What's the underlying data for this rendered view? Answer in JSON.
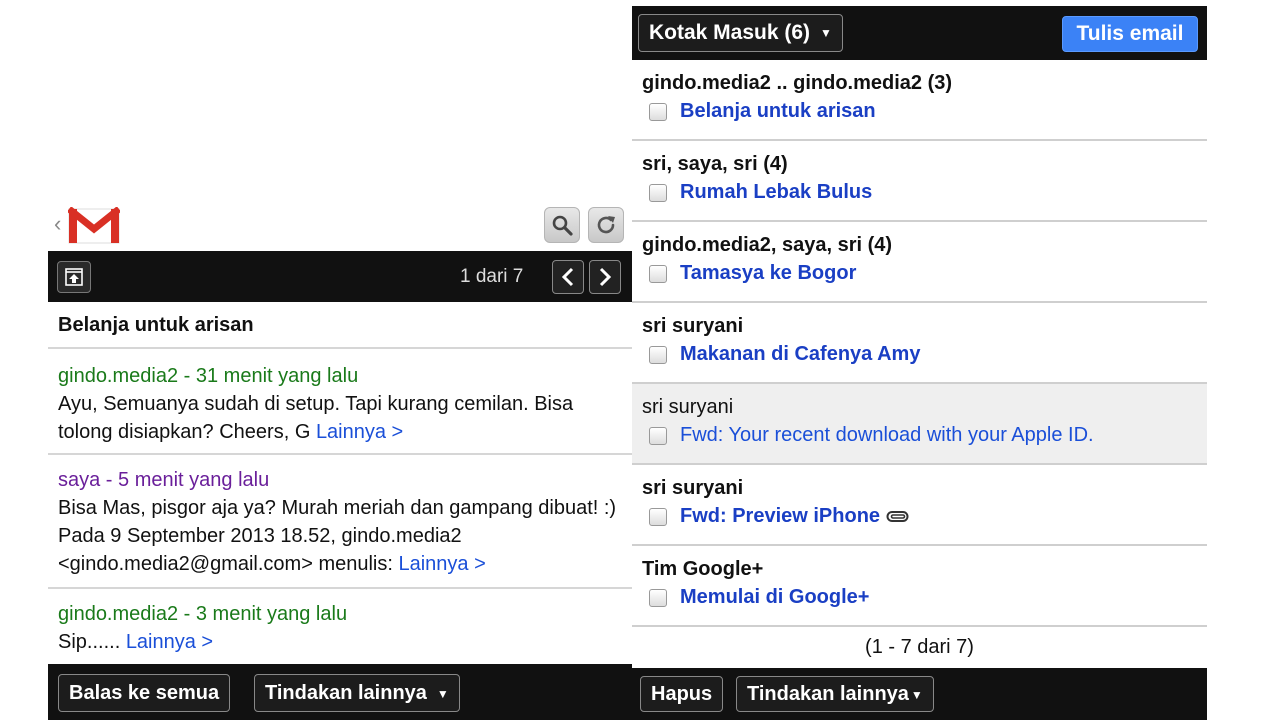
{
  "left": {
    "header": {
      "icons": [
        "back-chevron-icon",
        "gmail-logo",
        "search-icon",
        "refresh-icon"
      ]
    },
    "toolbar": {
      "pager_text": "1 dari 7"
    },
    "thread_subject": "Belanja untuk arisan",
    "messages": [
      {
        "head": "gindo.media2 - 31 menit yang lalu",
        "color": "#1a7a1a",
        "body": "Ayu, Semuanya sudah di setup. Tapi kurang cemilan. Bisa tolong disiapkan? Cheers, G ",
        "more": "Lainnya >"
      },
      {
        "head": "saya - 5 menit yang lalu",
        "color": "#6a1f9a",
        "body": "Bisa Mas, pisgor aja ya? Murah meriah dan gampang dibuat! :) Pada 9 September 2013 18.52, gindo.media2 <gindo.media2@gmail.com> menulis: ",
        "more": "Lainnya >"
      },
      {
        "head": "gindo.media2 - 3 menit yang lalu",
        "color": "#1a7a1a",
        "body": "Sip...... ",
        "more": "Lainnya >"
      }
    ],
    "bottombar": {
      "reply_all": "Balas ke semua",
      "more_actions": "Tindakan lainnya"
    }
  },
  "right": {
    "topbar": {
      "inbox_label": "Kotak Masuk (6)",
      "compose_label": "Tulis email"
    },
    "threads": [
      {
        "senders": "gindo.media2 .. gindo.media2 (3)",
        "subject": "Belanja untuk arisan",
        "read": false,
        "attachment": false
      },
      {
        "senders": "sri, saya, sri (4)",
        "subject": "Rumah Lebak Bulus",
        "read": false,
        "attachment": false
      },
      {
        "senders": "gindo.media2, saya, sri (4)",
        "subject": "Tamasya ke Bogor",
        "read": false,
        "attachment": false
      },
      {
        "senders": "sri suryani",
        "subject": "Makanan di Cafenya Amy",
        "read": false,
        "attachment": false
      },
      {
        "senders": "sri suryani",
        "subject": "Fwd: Your recent download with your Apple ID.",
        "read": true,
        "attachment": false
      },
      {
        "senders": "sri suryani",
        "subject": "Fwd: Preview iPhone",
        "read": false,
        "attachment": true
      },
      {
        "senders": "Tim Google+",
        "subject": "Memulai di Google+",
        "read": false,
        "attachment": false
      }
    ],
    "range_text": "(1 - 7 dari 7)",
    "bottombar": {
      "delete_label": "Hapus",
      "more_actions": "Tindakan lainnya"
    }
  }
}
